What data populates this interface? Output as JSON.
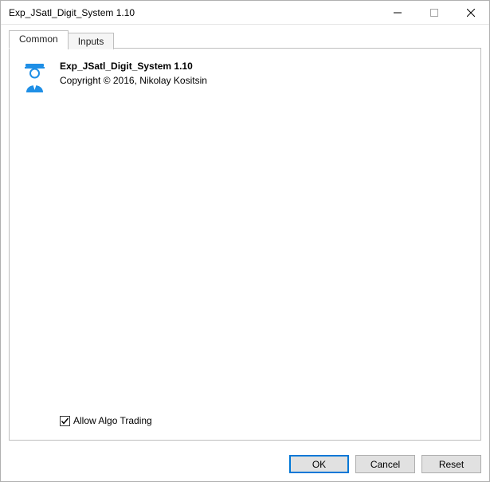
{
  "window": {
    "title": "Exp_JSatl_Digit_System 1.10"
  },
  "tabs": {
    "common": "Common",
    "inputs": "Inputs"
  },
  "content": {
    "title": "Exp_JSatl_Digit_System 1.10",
    "copyright": "Copyright © 2016, Nikolay Kositsin"
  },
  "checkbox": {
    "allow_algo_label": "Allow Algo Trading",
    "allow_algo_checked": true
  },
  "buttons": {
    "ok": "OK",
    "cancel": "Cancel",
    "reset": "Reset"
  }
}
